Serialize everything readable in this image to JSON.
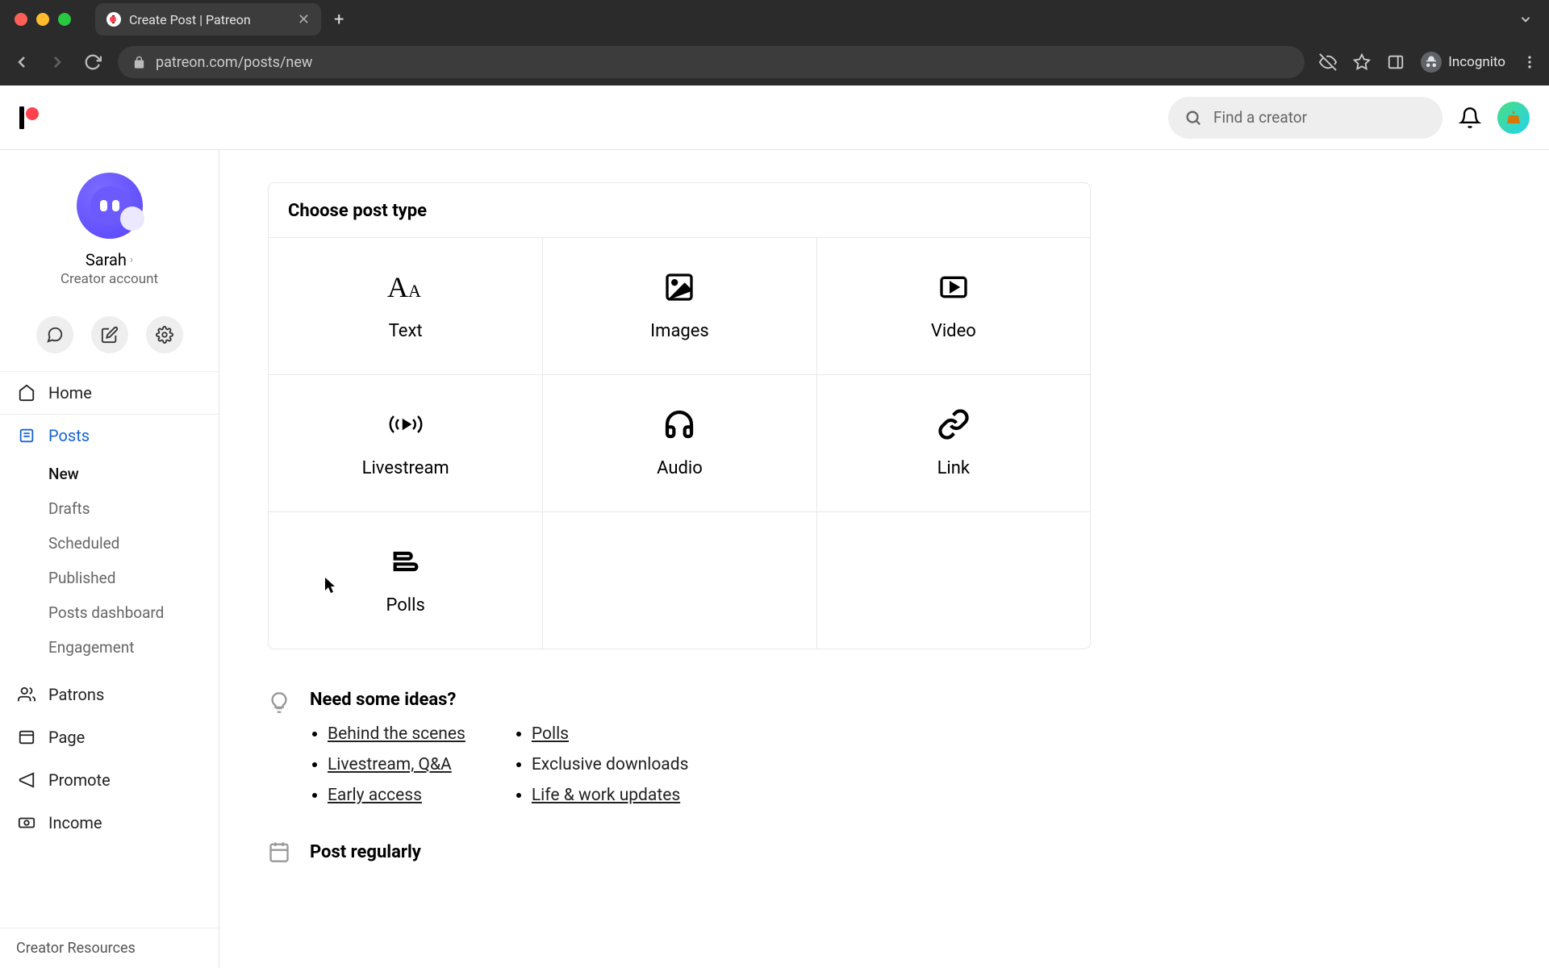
{
  "browser": {
    "tab_title": "Create Post | Patreon",
    "url": "patreon.com/posts/new",
    "incognito_label": "Incognito"
  },
  "header": {
    "search_placeholder": "Find a creator"
  },
  "sidebar": {
    "creator_name": "Sarah",
    "creator_sub": "Creator account",
    "nav": {
      "home": "Home",
      "posts": "Posts",
      "patrons": "Patrons",
      "page": "Page",
      "promote": "Promote",
      "income": "Income"
    },
    "posts_sub": {
      "new": "New",
      "drafts": "Drafts",
      "scheduled": "Scheduled",
      "published": "Published",
      "dashboard": "Posts dashboard",
      "engagement": "Engagement"
    },
    "creator_resources": "Creator Resources"
  },
  "main": {
    "choose_title": "Choose post type",
    "types": {
      "text": "Text",
      "images": "Images",
      "video": "Video",
      "livestream": "Livestream",
      "audio": "Audio",
      "link": "Link",
      "polls": "Polls"
    },
    "ideas_title": "Need some ideas?",
    "ideas_col1": {
      "i0": "Behind the scenes",
      "i1": "Livestream, Q&A",
      "i2": "Early access"
    },
    "ideas_col2": {
      "i0": "Polls",
      "i1": "Exclusive downloads",
      "i2": "Life & work updates"
    },
    "post_regularly": "Post regularly"
  }
}
